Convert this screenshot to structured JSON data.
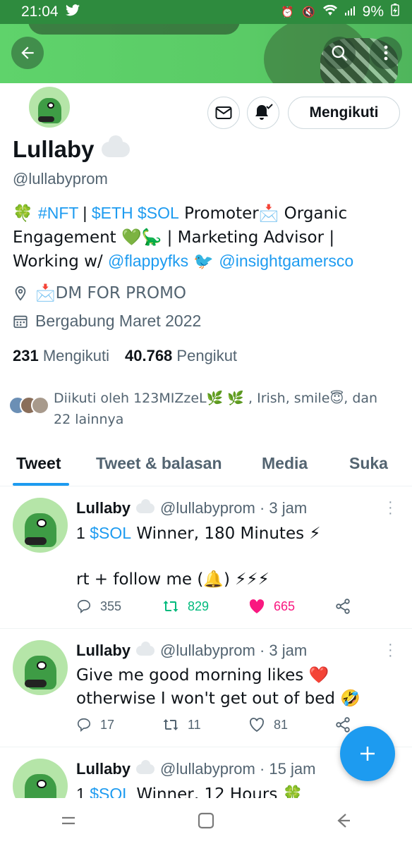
{
  "status_bar": {
    "time": "21:04",
    "battery": "9%"
  },
  "profile": {
    "name": "Lullaby",
    "handle": "@lullabyprom",
    "follow_button": "Mengikuti",
    "bio": {
      "line1_prefix": "🍀 ",
      "tag_nft": "#NFT",
      "sep1": " | ",
      "tag_eth": "$ETH",
      "space": " ",
      "tag_sol": "$SOL",
      "line1_rest": " Promoter📩 Organic Engagement 💚🦕 | Marketing Advisor | Working w/ ",
      "mention1": "@flappyfks",
      "between": " 🐦 ",
      "mention2": "@insightgamersco"
    },
    "location": "📩DM FOR PROMO",
    "joined": "Bergabung Maret 2022",
    "following_count": "231",
    "following_label": "Mengikuti",
    "followers_count": "40.768",
    "followers_label": "Pengikut",
    "followed_by": "Diikuti oleh 123MIZzeL🌿 🌿 , Irish, smile😇, dan 22 lainnya"
  },
  "tabs": [
    {
      "label": "Tweet"
    },
    {
      "label": "Tweet & balasan"
    },
    {
      "label": "Media"
    },
    {
      "label": "Suka"
    }
  ],
  "tweets": [
    {
      "name": "Lullaby",
      "handle": "@lullabyprom · 3 jam",
      "text_pre": "1 ",
      "text_link": "$SOL",
      "text_post": " Winner, 180 Minutes ⚡",
      "text_line2": "rt + follow me (🔔) ⚡⚡⚡",
      "replies": "355",
      "retweets": "829",
      "likes": "665"
    },
    {
      "name": "Lullaby",
      "handle": "@lullabyprom · 3 jam",
      "text": "Give me good morning likes ❤️ otherwise I won't get out of bed 🤣",
      "replies": "17",
      "retweets": "11",
      "likes": "81"
    },
    {
      "name": "Lullaby",
      "handle": "@lullabyprom · 15 jam",
      "text_pre": "1 ",
      "text_link": "$SOL",
      "text_post": " Winner, 12 Hours 🍀"
    }
  ],
  "colors": {
    "accent": "#1d9bf0",
    "banner": "#5acb66",
    "retweet": "#00ba7c",
    "like": "#f91880"
  }
}
